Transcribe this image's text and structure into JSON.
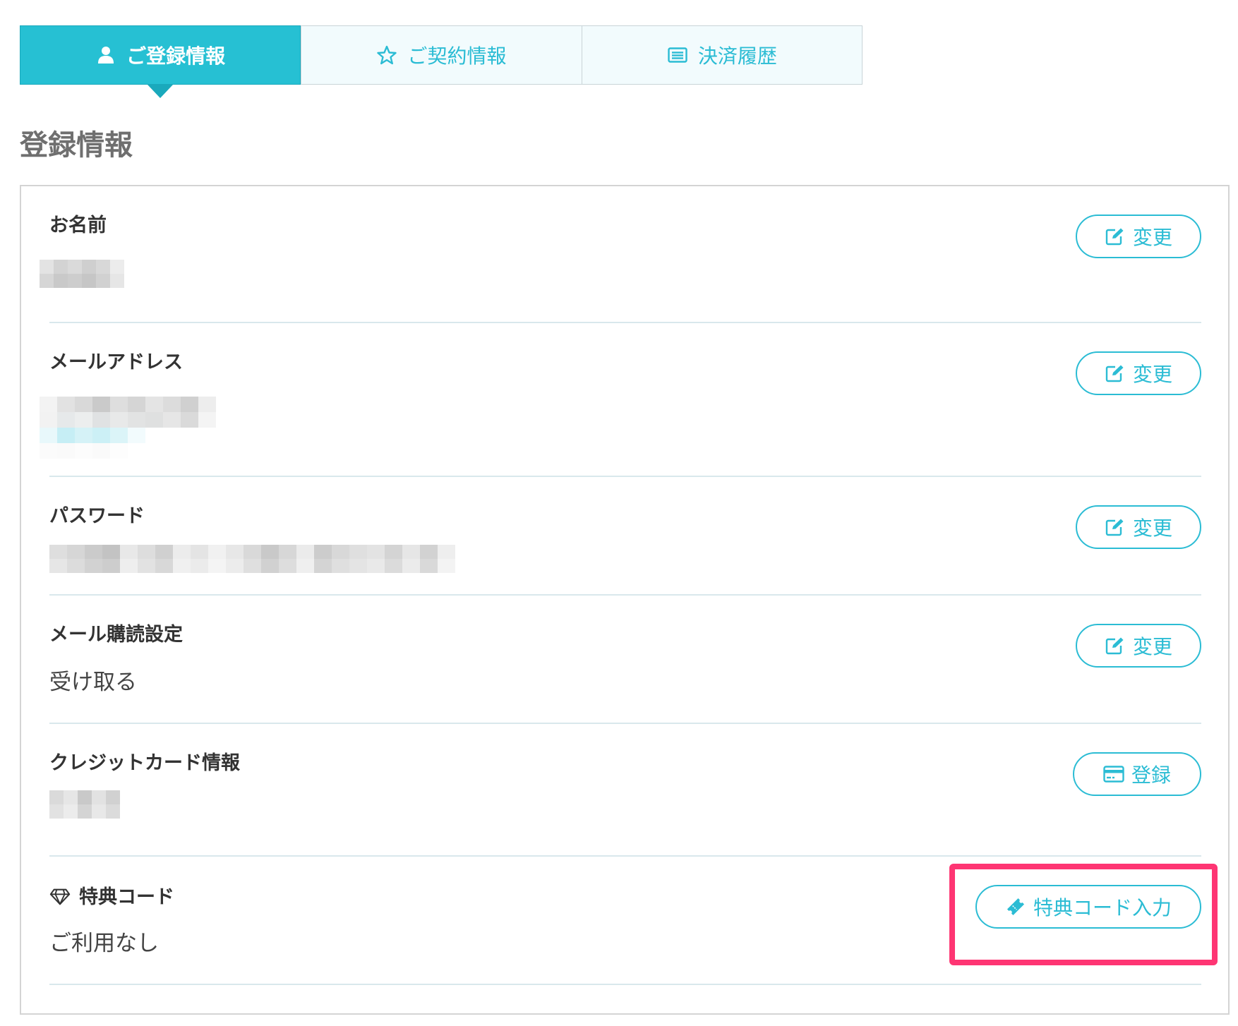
{
  "tabs": [
    {
      "label": "ご登録情報",
      "icon": "user-icon",
      "active": true
    },
    {
      "label": "ご契約情報",
      "icon": "star-icon",
      "active": false
    },
    {
      "label": "決済履歴",
      "icon": "list-icon",
      "active": false
    }
  ],
  "section_title": "登録情報",
  "rows": {
    "name": {
      "label": "お名前",
      "button": "変更",
      "button_icon": "edit-icon"
    },
    "email": {
      "label": "メールアドレス",
      "button": "変更",
      "button_icon": "edit-icon"
    },
    "password": {
      "label": "パスワード",
      "button": "変更",
      "button_icon": "edit-icon"
    },
    "mail_subscription": {
      "label": "メール購読設定",
      "value": "受け取る",
      "button": "変更",
      "button_icon": "edit-icon"
    },
    "credit_card": {
      "label": "クレジットカード情報",
      "button": "登録",
      "button_icon": "credit-card-icon"
    },
    "coupon": {
      "label": "特典コード",
      "label_icon": "diamond-icon",
      "value": "ご利用なし",
      "button": "特典コード入力",
      "button_icon": "ticket-icon"
    }
  },
  "colors": {
    "accent": "#26c0d3",
    "highlight": "#fe3573"
  }
}
